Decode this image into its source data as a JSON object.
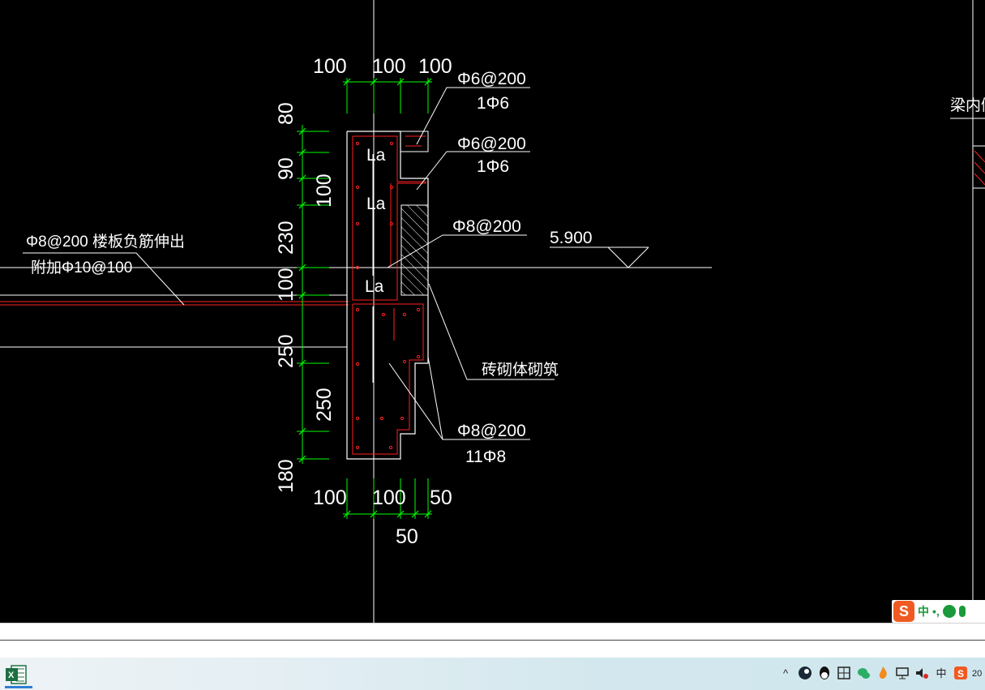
{
  "drawing": {
    "top_dims": [
      "100",
      "100",
      "100"
    ],
    "bottom_dims": [
      "100",
      "100",
      "50"
    ],
    "bottom_dim_extra": "50",
    "left_dims": [
      "80",
      "90",
      "100",
      "230",
      "100",
      "250",
      "250",
      "180"
    ],
    "labels": {
      "rebar1_top": "Φ6@200",
      "rebar1_bottom": "1Φ6",
      "rebar2_top": "Φ6@200",
      "rebar2_bottom": "1Φ6",
      "rebar3": "Φ8@200",
      "elevation": "5.900",
      "slab_rebar": "Φ8@200 楼板负筋伸出",
      "slab_additional": "附加Φ10@100",
      "anchor_1": "La",
      "anchor_2": "La",
      "anchor_3": "La",
      "masonry": "砖砌体砌筑",
      "rebar4_top": "Φ8@200",
      "rebar4_bottom": "11Φ8",
      "right_panel_title": "梁内侧"
    },
    "colors": {
      "background": "#000000",
      "outline": "#ffffff",
      "rebar": "#ff2020",
      "dimension": "#00ff00"
    }
  },
  "ime": {
    "logo": "S",
    "mode": "中",
    "punct": "•,"
  },
  "taskbar": {
    "app_icon": "excel-icon",
    "tray": {
      "up": "^",
      "ime_mode": "中",
      "clock": "20"
    }
  }
}
